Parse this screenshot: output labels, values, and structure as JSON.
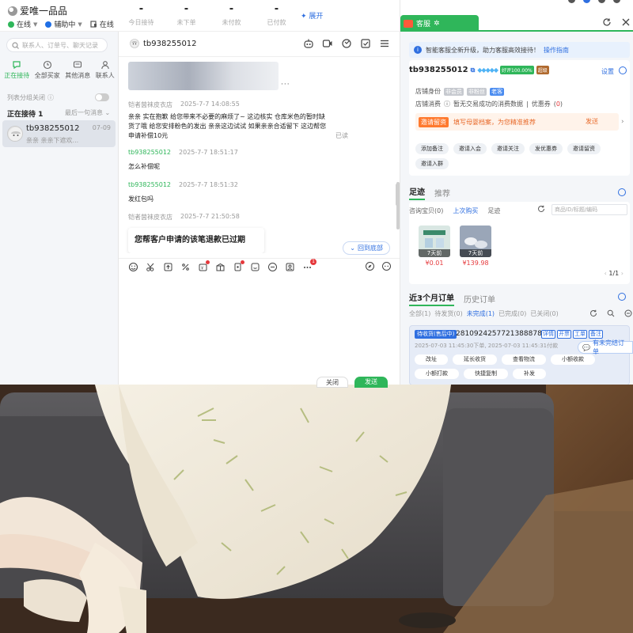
{
  "app": {
    "name": "爱唯一品品",
    "status": [
      {
        "label": "在线",
        "color": "#2fb65a"
      },
      {
        "label": "辅助中",
        "color": "#1f6fe5"
      },
      {
        "label": "在线",
        "color": "#555555"
      }
    ],
    "stats": [
      {
        "label": "今日接待",
        "value": "-"
      },
      {
        "label": "未下单",
        "value": "-"
      },
      {
        "label": "未付款",
        "value": "-"
      },
      {
        "label": "已付款",
        "value": "-"
      }
    ],
    "expand_label": "展开"
  },
  "sidebar": {
    "search_placeholder": "联系人、订单号、聊天记录",
    "tabs": [
      {
        "label": "正在接待",
        "icon": "chat-bubble-icon",
        "active": true
      },
      {
        "label": "全部买家",
        "icon": "clock-icon",
        "active": false
      },
      {
        "label": "其他消息",
        "icon": "message-icon",
        "active": false
      },
      {
        "label": "联系人",
        "icon": "person-icon",
        "active": false
      }
    ],
    "group_toggle_label": "列表分组关闭",
    "queue_title": "正在接待",
    "queue_count": "1",
    "sort_label": "最后一句消息",
    "conversation": {
      "name": "tb938255012",
      "date": "07-09",
      "snippet": "亲亲 亲亲下遮欢..."
    }
  },
  "chat": {
    "buyer_name": "tb938255012",
    "messages": [
      {
        "sender": "铠者茵袜皮衣店",
        "time": "2025-7-7 14:08:55",
        "text_lines": [
          "亲亲 实在抱歉 给您带来不必要的麻烦了~ 这边核实 仓库米色的暂时缺",
          "货了哦 给您安排粉色的发出 亲亲这边试试 如果亲亲合适留下 这边帮您",
          "申请补偿10元"
        ],
        "read": "已读"
      },
      {
        "sender": "tb938255012",
        "time": "2025-7-7 18:51:17",
        "text": "怎么补偿呢"
      },
      {
        "sender": "tb938255012",
        "time": "2025-7-7 18:51:32",
        "text": "发红包吗"
      },
      {
        "sender": "铠者茵袜皮衣店",
        "time": "2025-7-7 21:50:58"
      }
    ],
    "card_text": "您帮客户申请的该笔退款已过期",
    "back_to_bottom": "回到底部",
    "close_label": "关闭",
    "send_label": "发送",
    "badge_count": "1"
  },
  "panel": {
    "tab_label": "客服",
    "notice": "智能客服全新升级，助力客服高效接待！",
    "notice_link": "操作指南",
    "user": {
      "name": "tb938255012",
      "good_rate": "好评100.00%",
      "vip": "超级"
    },
    "settings_label": "设置",
    "shop_identity_label": "店铺身份",
    "shop_tags": [
      {
        "text": "非会员",
        "style": "grey"
      },
      {
        "text": "非粉丝",
        "style": "grey"
      },
      {
        "text": "老客",
        "style": "blue"
      }
    ],
    "consume_label": "店铺消费",
    "consume_text": "暂无交易成功的消费数据",
    "coupon_label": "优惠券",
    "coupon_count": "0",
    "invite": {
      "label": "邀请留资",
      "hint": "填写母婴档案，为您精准推荐",
      "action": "发送"
    },
    "quick_actions": [
      "添加备注",
      "邀请入会",
      "邀请关注",
      "发优惠券",
      "邀请留资",
      "邀请入群"
    ],
    "footprint": {
      "tabs": [
        "足迹",
        "推荐"
      ],
      "sub_tabs": [
        "咨询宝贝",
        "上次购买",
        "足迹"
      ],
      "sub_count": "0",
      "search_placeholder": "商品ID/标题/编码",
      "products": [
        {
          "days": "7天前",
          "price": "¥0.01",
          "color": "#d9e7e3"
        },
        {
          "days": "7天前",
          "price": "¥139.98",
          "color": "#9aa6b8"
        }
      ],
      "page": "1/1"
    },
    "orders": {
      "tabs": [
        "近3个月订单",
        "历史订单"
      ],
      "filters": [
        {
          "label": "全部",
          "count": "1"
        },
        {
          "label": "待发货",
          "count": "0"
        },
        {
          "label": "未完成",
          "count": "1"
        },
        {
          "label": "已完成",
          "count": "0"
        },
        {
          "label": "已关闭",
          "count": "0"
        }
      ],
      "order": {
        "status": "待收货(售后中)",
        "number": "2810924257721388878",
        "chips": [
          "详情",
          "开票",
          "工单",
          "备注"
        ],
        "time": "2025-07-03 11:45:30下单, 2025-07-03 11:45:31付款",
        "actions": [
          "改址",
          "延长收货",
          "查看物流",
          "小额收款",
          "小额打款",
          "快捷复制",
          "补发"
        ]
      },
      "unfinished_label": "有未完结订单"
    }
  }
}
